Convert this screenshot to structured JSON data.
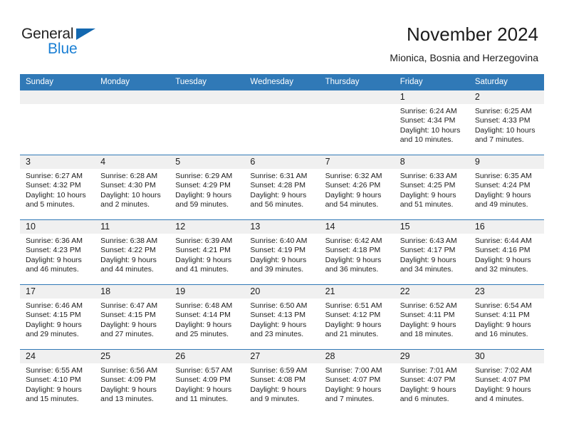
{
  "logo": {
    "word1": "General",
    "word2": "Blue",
    "triangle_color": "#1368b0",
    "blue_color": "#1a7fd4"
  },
  "header": {
    "title": "November 2024",
    "subtitle": "Mionica, Bosnia and Herzegovina"
  },
  "theme": {
    "header_blue": "#3079b7",
    "daynum_band_gray": "#f0f0f0",
    "text_color": "#1c1c1c"
  },
  "weekday_headers": [
    "Sunday",
    "Monday",
    "Tuesday",
    "Wednesday",
    "Thursday",
    "Friday",
    "Saturday"
  ],
  "weeks": [
    [
      {
        "day": "",
        "empty": true
      },
      {
        "day": "",
        "empty": true
      },
      {
        "day": "",
        "empty": true
      },
      {
        "day": "",
        "empty": true
      },
      {
        "day": "",
        "empty": true
      },
      {
        "day": "1",
        "sunrise": "Sunrise: 6:24 AM",
        "sunset": "Sunset: 4:34 PM",
        "daylight": "Daylight: 10 hours and 10 minutes."
      },
      {
        "day": "2",
        "sunrise": "Sunrise: 6:25 AM",
        "sunset": "Sunset: 4:33 PM",
        "daylight": "Daylight: 10 hours and 7 minutes."
      }
    ],
    [
      {
        "day": "3",
        "sunrise": "Sunrise: 6:27 AM",
        "sunset": "Sunset: 4:32 PM",
        "daylight": "Daylight: 10 hours and 5 minutes."
      },
      {
        "day": "4",
        "sunrise": "Sunrise: 6:28 AM",
        "sunset": "Sunset: 4:30 PM",
        "daylight": "Daylight: 10 hours and 2 minutes."
      },
      {
        "day": "5",
        "sunrise": "Sunrise: 6:29 AM",
        "sunset": "Sunset: 4:29 PM",
        "daylight": "Daylight: 9 hours and 59 minutes."
      },
      {
        "day": "6",
        "sunrise": "Sunrise: 6:31 AM",
        "sunset": "Sunset: 4:28 PM",
        "daylight": "Daylight: 9 hours and 56 minutes."
      },
      {
        "day": "7",
        "sunrise": "Sunrise: 6:32 AM",
        "sunset": "Sunset: 4:26 PM",
        "daylight": "Daylight: 9 hours and 54 minutes."
      },
      {
        "day": "8",
        "sunrise": "Sunrise: 6:33 AM",
        "sunset": "Sunset: 4:25 PM",
        "daylight": "Daylight: 9 hours and 51 minutes."
      },
      {
        "day": "9",
        "sunrise": "Sunrise: 6:35 AM",
        "sunset": "Sunset: 4:24 PM",
        "daylight": "Daylight: 9 hours and 49 minutes."
      }
    ],
    [
      {
        "day": "10",
        "sunrise": "Sunrise: 6:36 AM",
        "sunset": "Sunset: 4:23 PM",
        "daylight": "Daylight: 9 hours and 46 minutes."
      },
      {
        "day": "11",
        "sunrise": "Sunrise: 6:38 AM",
        "sunset": "Sunset: 4:22 PM",
        "daylight": "Daylight: 9 hours and 44 minutes."
      },
      {
        "day": "12",
        "sunrise": "Sunrise: 6:39 AM",
        "sunset": "Sunset: 4:21 PM",
        "daylight": "Daylight: 9 hours and 41 minutes."
      },
      {
        "day": "13",
        "sunrise": "Sunrise: 6:40 AM",
        "sunset": "Sunset: 4:19 PM",
        "daylight": "Daylight: 9 hours and 39 minutes."
      },
      {
        "day": "14",
        "sunrise": "Sunrise: 6:42 AM",
        "sunset": "Sunset: 4:18 PM",
        "daylight": "Daylight: 9 hours and 36 minutes."
      },
      {
        "day": "15",
        "sunrise": "Sunrise: 6:43 AM",
        "sunset": "Sunset: 4:17 PM",
        "daylight": "Daylight: 9 hours and 34 minutes."
      },
      {
        "day": "16",
        "sunrise": "Sunrise: 6:44 AM",
        "sunset": "Sunset: 4:16 PM",
        "daylight": "Daylight: 9 hours and 32 minutes."
      }
    ],
    [
      {
        "day": "17",
        "sunrise": "Sunrise: 6:46 AM",
        "sunset": "Sunset: 4:15 PM",
        "daylight": "Daylight: 9 hours and 29 minutes."
      },
      {
        "day": "18",
        "sunrise": "Sunrise: 6:47 AM",
        "sunset": "Sunset: 4:15 PM",
        "daylight": "Daylight: 9 hours and 27 minutes."
      },
      {
        "day": "19",
        "sunrise": "Sunrise: 6:48 AM",
        "sunset": "Sunset: 4:14 PM",
        "daylight": "Daylight: 9 hours and 25 minutes."
      },
      {
        "day": "20",
        "sunrise": "Sunrise: 6:50 AM",
        "sunset": "Sunset: 4:13 PM",
        "daylight": "Daylight: 9 hours and 23 minutes."
      },
      {
        "day": "21",
        "sunrise": "Sunrise: 6:51 AM",
        "sunset": "Sunset: 4:12 PM",
        "daylight": "Daylight: 9 hours and 21 minutes."
      },
      {
        "day": "22",
        "sunrise": "Sunrise: 6:52 AM",
        "sunset": "Sunset: 4:11 PM",
        "daylight": "Daylight: 9 hours and 18 minutes."
      },
      {
        "day": "23",
        "sunrise": "Sunrise: 6:54 AM",
        "sunset": "Sunset: 4:11 PM",
        "daylight": "Daylight: 9 hours and 16 minutes."
      }
    ],
    [
      {
        "day": "24",
        "sunrise": "Sunrise: 6:55 AM",
        "sunset": "Sunset: 4:10 PM",
        "daylight": "Daylight: 9 hours and 15 minutes."
      },
      {
        "day": "25",
        "sunrise": "Sunrise: 6:56 AM",
        "sunset": "Sunset: 4:09 PM",
        "daylight": "Daylight: 9 hours and 13 minutes."
      },
      {
        "day": "26",
        "sunrise": "Sunrise: 6:57 AM",
        "sunset": "Sunset: 4:09 PM",
        "daylight": "Daylight: 9 hours and 11 minutes."
      },
      {
        "day": "27",
        "sunrise": "Sunrise: 6:59 AM",
        "sunset": "Sunset: 4:08 PM",
        "daylight": "Daylight: 9 hours and 9 minutes."
      },
      {
        "day": "28",
        "sunrise": "Sunrise: 7:00 AM",
        "sunset": "Sunset: 4:07 PM",
        "daylight": "Daylight: 9 hours and 7 minutes."
      },
      {
        "day": "29",
        "sunrise": "Sunrise: 7:01 AM",
        "sunset": "Sunset: 4:07 PM",
        "daylight": "Daylight: 9 hours and 6 minutes."
      },
      {
        "day": "30",
        "sunrise": "Sunrise: 7:02 AM",
        "sunset": "Sunset: 4:07 PM",
        "daylight": "Daylight: 9 hours and 4 minutes."
      }
    ]
  ]
}
